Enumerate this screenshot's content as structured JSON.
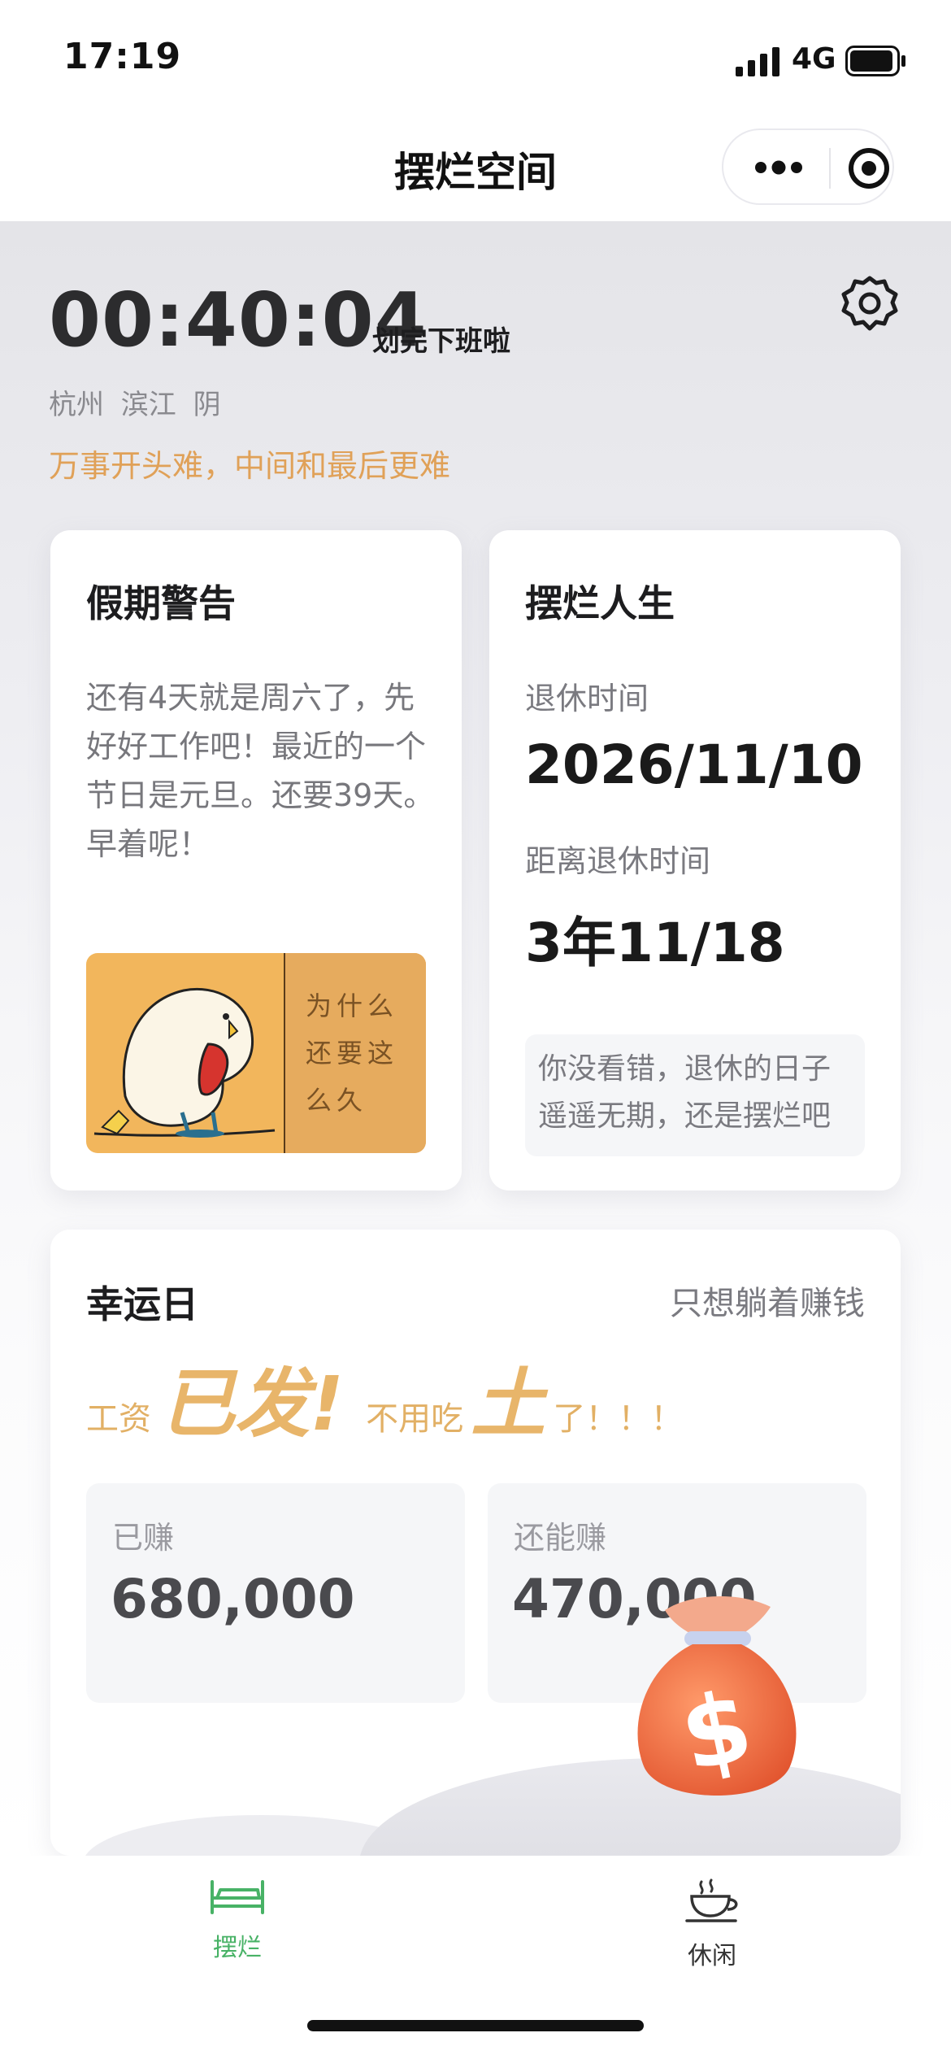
{
  "status_bar": {
    "time": "17:19",
    "network": "4G"
  },
  "nav": {
    "title": "摆烂空间"
  },
  "header": {
    "timer": "00:40:04",
    "timer_suffix": "划完下班啦",
    "location": "杭州 滨江 阴",
    "motto": "万事开头难，中间和最后更难"
  },
  "holiday_card": {
    "title": "假期警告",
    "text": "还有4天就是周六了，先好好工作吧！最近的一个节日是元旦。还要39天。早着呢！",
    "meme_caption": "为什么还要这么久"
  },
  "retire_card": {
    "title": "摆烂人生",
    "retire_label": "退休时间",
    "retire_date": "2026/11/10",
    "countdown_label": "距离退休时间",
    "countdown_value": "3年11/18",
    "note": "你没看错，退休的日子遥遥无期，还是摆烂吧"
  },
  "lucky_card": {
    "title": "幸运日",
    "subtitle": "只想躺着赚钱",
    "slogan": {
      "part1": "工资",
      "big1": "已发!",
      "part2": "不用吃",
      "big2": "土",
      "part3": "了！！！"
    },
    "earned_label": "已赚",
    "earned_value": "680,000",
    "remain_label": "还能赚",
    "remain_value": "470,000"
  },
  "tabs": [
    {
      "label": "摆烂",
      "icon": "bed-icon",
      "active": true
    },
    {
      "label": "休闲",
      "icon": "coffee-cup-icon",
      "active": false
    }
  ],
  "colors": {
    "accent_orange": "#e0a158",
    "active_tab_green": "#48b266",
    "gold_text": "#e8b56a"
  }
}
